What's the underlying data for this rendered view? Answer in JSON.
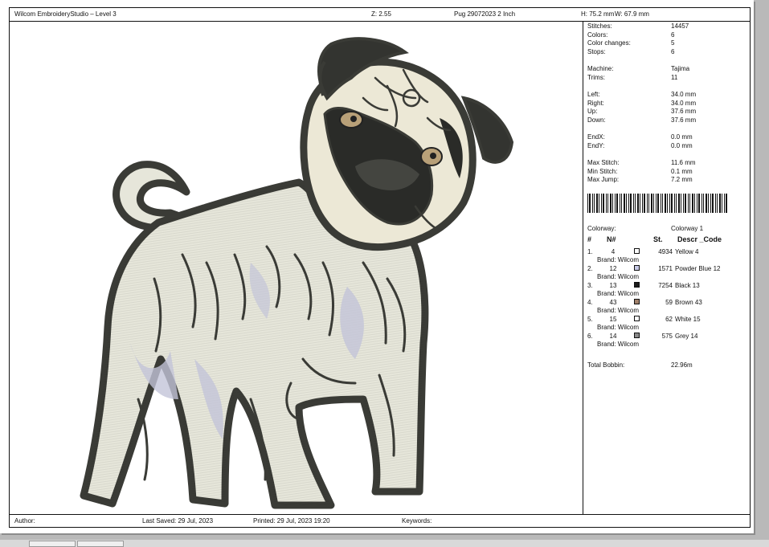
{
  "header": {
    "app_title": "Wilcom EmbroideryStudio – Level 3",
    "zoom": "Z: 2.55",
    "design_name": "Pug 29072023 2 Inch",
    "height": "H: 75.2 mm",
    "width": "W: 67.9 mm"
  },
  "stats": [
    {
      "label": "Stitches:",
      "value": "14457"
    },
    {
      "label": "Colors:",
      "value": "6"
    },
    {
      "label": "Color changes:",
      "value": "5"
    },
    {
      "label": "Stops:",
      "value": "6"
    },
    {
      "label": "Machine:",
      "value": "Tajima"
    },
    {
      "label": "Trims:",
      "value": "11"
    },
    {
      "label": "Left:",
      "value": "34.0 mm"
    },
    {
      "label": "Right:",
      "value": "34.0 mm"
    },
    {
      "label": "Up:",
      "value": "37.6 mm"
    },
    {
      "label": "Down:",
      "value": "37.6 mm"
    },
    {
      "label": "EndX:",
      "value": "0.0 mm"
    },
    {
      "label": "EndY:",
      "value": "0.0 mm"
    },
    {
      "label": "Max Stitch:",
      "value": "11.6 mm"
    },
    {
      "label": "Min Stitch:",
      "value": "0.1 mm"
    },
    {
      "label": "Max Jump:",
      "value": "7.2 mm"
    }
  ],
  "colorway": {
    "label": "Colorway:",
    "value": "Colorway 1"
  },
  "table_headers": {
    "index": "#",
    "number": "N#",
    "stitches": "St.",
    "description": "Descr _Code"
  },
  "colors": [
    {
      "index": "1.",
      "number": "4",
      "brand": "Brand: Wilcom",
      "swatch": "#ffffff",
      "stitches": "4934",
      "description": "Yellow 4"
    },
    {
      "index": "2.",
      "number": "12",
      "brand": "Brand: Wilcom",
      "swatch": "#c7c9e6",
      "stitches": "1571",
      "description": "Powder Blue 12"
    },
    {
      "index": "3.",
      "number": "13",
      "brand": "Brand: Wilcom",
      "swatch": "#1c1c1c",
      "stitches": "7254",
      "description": "Black 13"
    },
    {
      "index": "4.",
      "number": "43",
      "brand": "Brand: Wilcom",
      "swatch": "#a0806a",
      "stitches": "59",
      "description": "Brown 43"
    },
    {
      "index": "5.",
      "number": "15",
      "brand": "Brand: Wilcom",
      "swatch": "#ffffff",
      "stitches": "62",
      "description": "White 15"
    },
    {
      "index": "6.",
      "number": "14",
      "brand": "Brand: Wilcom",
      "swatch": "#8a8a8a",
      "stitches": "575",
      "description": "Grey 14"
    }
  ],
  "total_bobbin": {
    "label": "Total Bobbin:",
    "value": "22.96m"
  },
  "footer": {
    "author": "Author:",
    "last_saved": "Last Saved: 29 Jul, 2023",
    "printed": "Printed: 29 Jul, 2023 19:20",
    "keywords": "Keywords:"
  },
  "palette": {
    "outline": "#3a3b36",
    "body": "#e6e6da",
    "blue_shadow": "#c3c4d8",
    "face": "#ece8d6",
    "ear": "#333430",
    "mask": "#2a2b28",
    "eye": "#b8a078"
  }
}
